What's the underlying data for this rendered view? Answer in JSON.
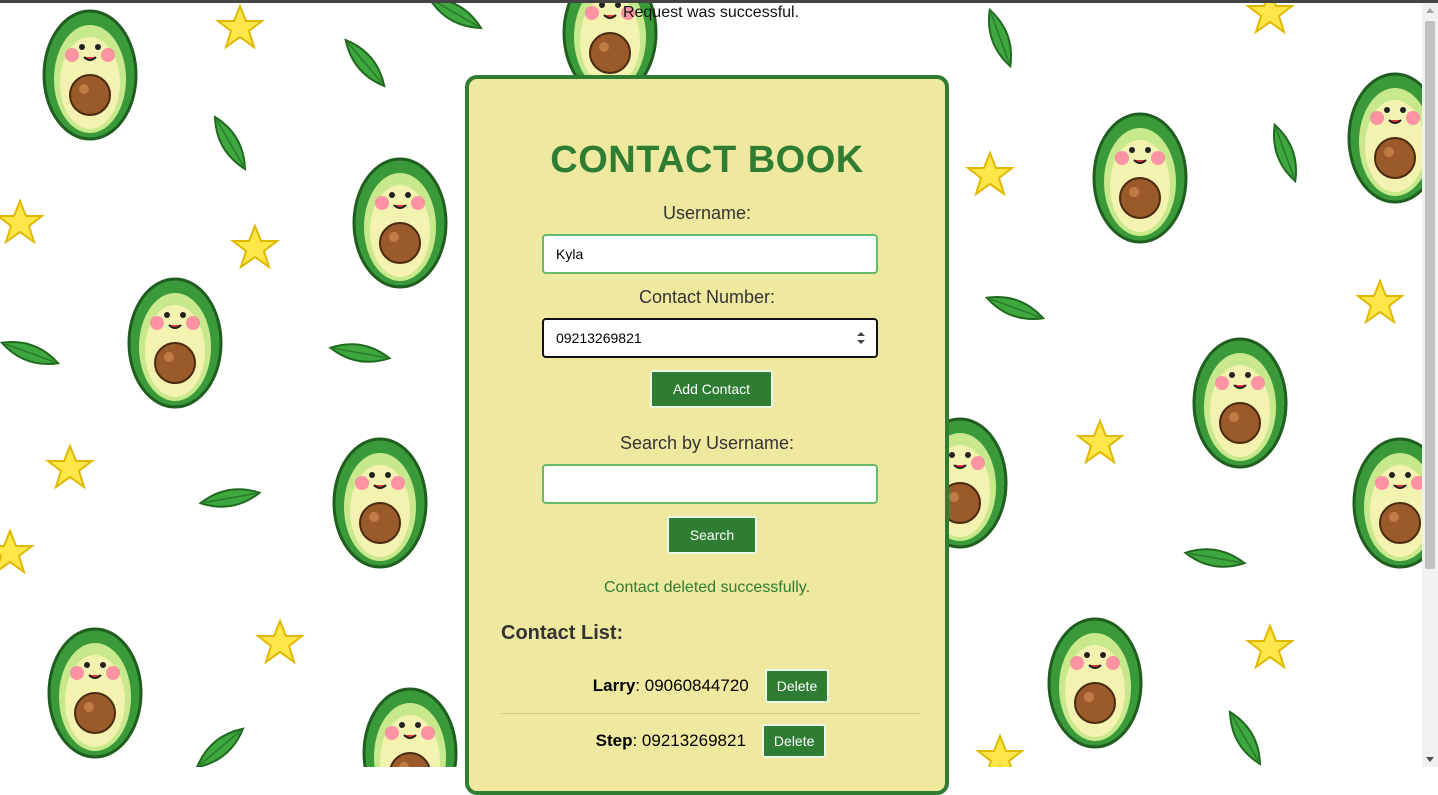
{
  "status_top": "Request was successful.",
  "app": {
    "title": "CONTACT BOOK",
    "username_label": "Username:",
    "username_value": "Kyla",
    "contact_label": "Contact Number:",
    "contact_value": "09213269821",
    "add_button": "Add Contact",
    "search_label": "Search by Username:",
    "search_value": "",
    "search_button": "Search",
    "message": "Contact deleted successfully.",
    "list_title": "Contact List:",
    "contacts": [
      {
        "name": "Larry",
        "number": "09060844720",
        "delete": "Delete"
      },
      {
        "name": "Step",
        "number": "09213269821",
        "delete": "Delete"
      }
    ]
  },
  "colors": {
    "accent": "#2e7d32",
    "card_bg": "#efe99f",
    "input_border": "#66bb6a"
  },
  "background": {
    "pattern": "avocado-characters",
    "icons": [
      "avocado-icon",
      "leaf-icon",
      "star-icon"
    ]
  }
}
